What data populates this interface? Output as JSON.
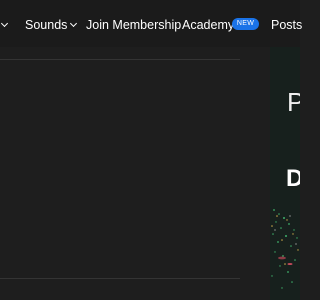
{
  "nav": {
    "prev_chevron_visible": true,
    "sounds": "Sounds",
    "membership": "Join Membership",
    "academy": "Academy",
    "academy_badge": "NEW",
    "posts": "Posts"
  },
  "promo": {
    "letter_1": "P",
    "letter_2": "D"
  },
  "colors": {
    "background": "#1e1e1e",
    "nav_background": "#1b1b1b",
    "badge": "#1a73e8",
    "promo_background": "#17201d"
  }
}
